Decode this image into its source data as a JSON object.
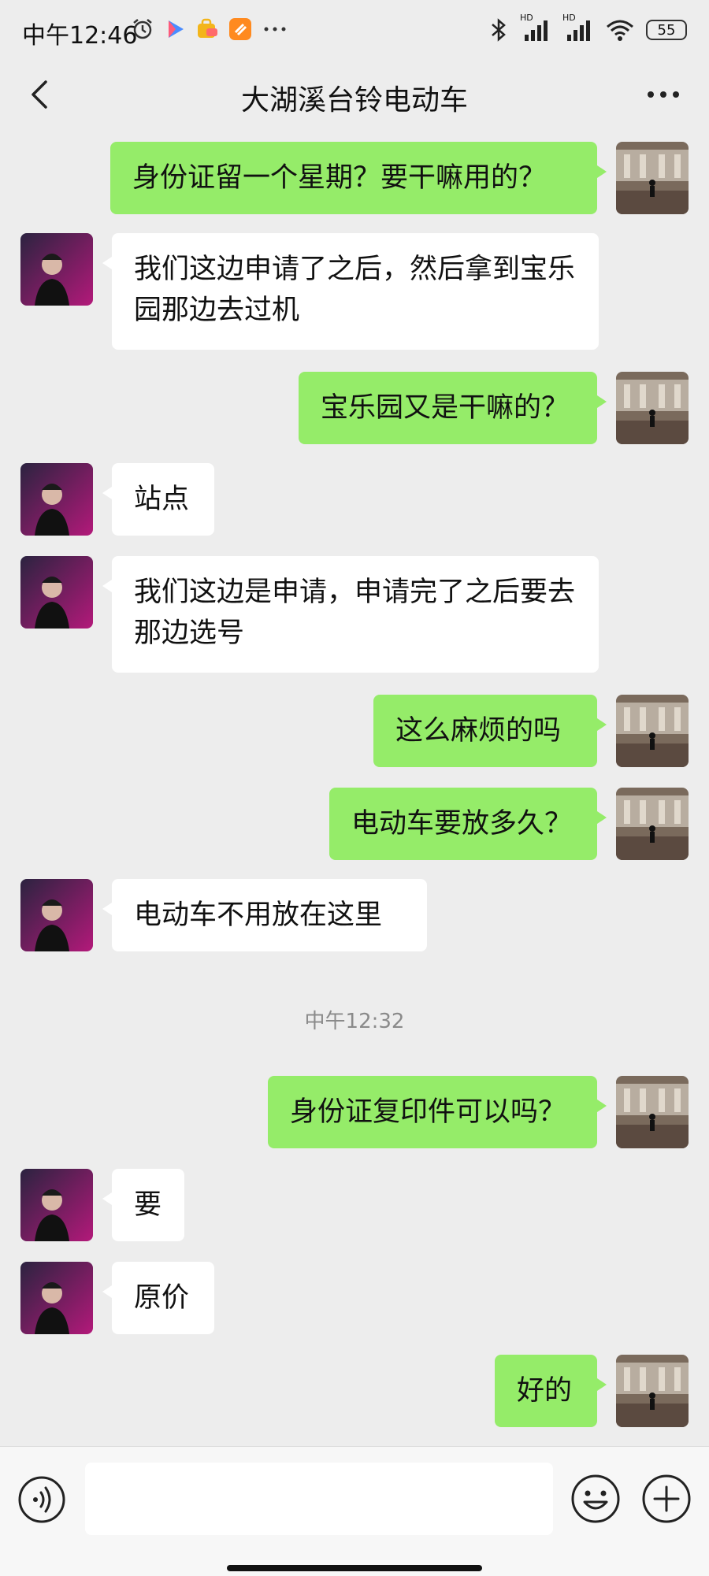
{
  "status_bar": {
    "time": "中午12:46",
    "battery": "55",
    "hd1": "HD",
    "hd2": "HD"
  },
  "header": {
    "title": "大湖溪台铃电动车"
  },
  "messages": [
    {
      "from": "me",
      "text": "身份证留一个星期？要干嘛用的？"
    },
    {
      "from": "them",
      "text": "我们这边申请了之后，然后拿到宝乐园那边去过机"
    },
    {
      "from": "me",
      "text": "宝乐园又是干嘛的？"
    },
    {
      "from": "them",
      "text": "站点"
    },
    {
      "from": "them",
      "text": "我们这边是申请，申请完了之后要去那边选号"
    },
    {
      "from": "me",
      "text": "这么麻烦的吗"
    },
    {
      "from": "me",
      "text": "电动车要放多久？"
    },
    {
      "from": "them",
      "text": "电动车不用放在这里"
    },
    {
      "from": "me",
      "text": "身份证复印件可以吗？"
    },
    {
      "from": "them",
      "text": "要"
    },
    {
      "from": "them",
      "text": "原价"
    },
    {
      "from": "me",
      "text": "好的"
    }
  ],
  "timestamp_divider": "中午12:32",
  "input": {
    "value": "",
    "placeholder": ""
  },
  "icons": {
    "back": "chevron-left-icon",
    "more": "more-dots-icon",
    "voice": "voice-icon",
    "emoji": "emoji-icon",
    "plus": "plus-icon"
  },
  "colors": {
    "my_bubble": "#95ec69",
    "their_bubble": "#ffffff",
    "background": "#ededed"
  }
}
